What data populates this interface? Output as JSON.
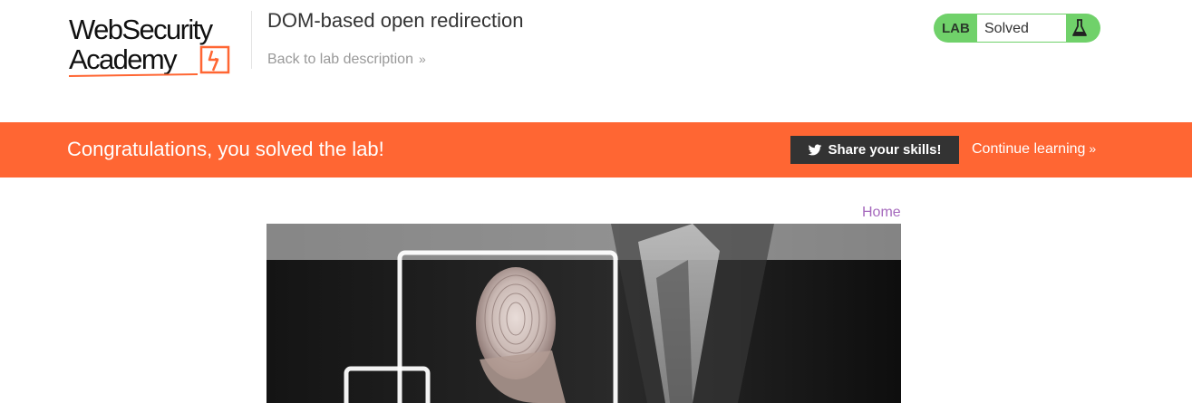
{
  "header": {
    "logo": {
      "line1": "WebSecurity",
      "line2": "Academy"
    },
    "lab_title": "DOM-based open redirection",
    "back_link": {
      "label": "Back to lab description",
      "chevron": "»"
    },
    "lab_status": {
      "label": "LAB",
      "value": "Solved",
      "icon": "flask-icon",
      "color": "#70d16a"
    }
  },
  "banner": {
    "message": "Congratulations, you solved the lab!",
    "share_button": "Share your skills!",
    "share_icon": "twitter-icon",
    "continue_link": "Continue learning",
    "continue_chevron": "»",
    "background": "#ff6633"
  },
  "content": {
    "home_link": "Home",
    "hero_image": "fingerprint-touchscreen-photo"
  },
  "colors": {
    "accent_orange": "#ff6633",
    "lab_green": "#70d16a",
    "link_purple": "#a569bd",
    "dark_button": "#333333"
  }
}
